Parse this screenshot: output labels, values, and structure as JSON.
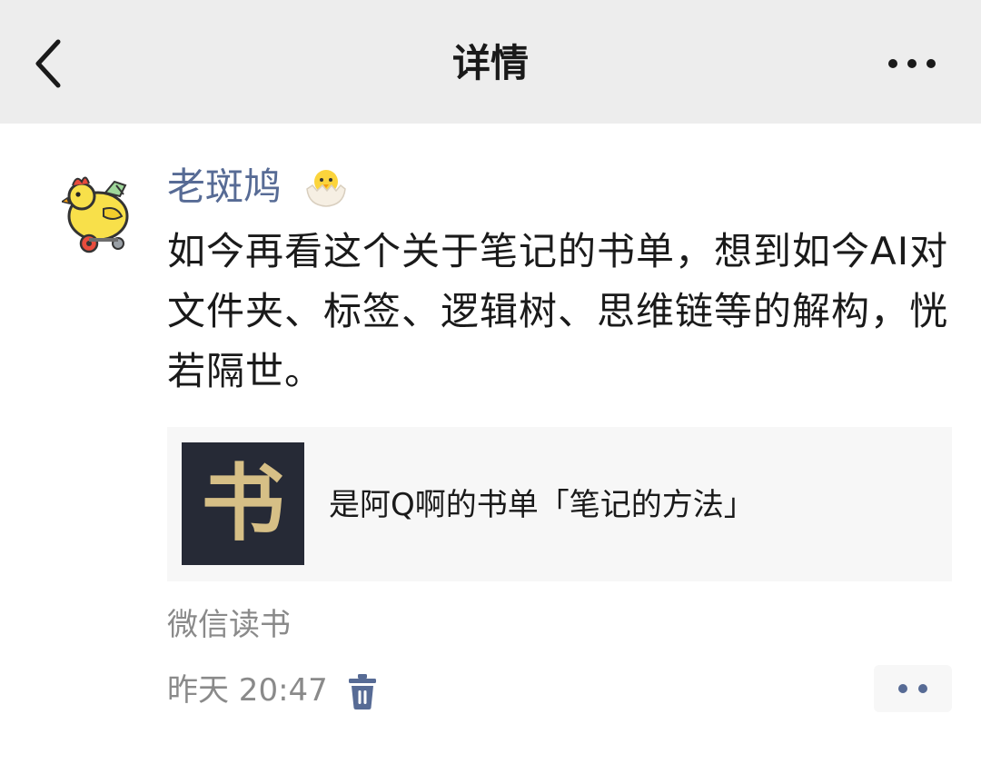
{
  "nav": {
    "title": "详情",
    "back_icon": "chevron-left-icon",
    "more_icon": "more-dots-icon"
  },
  "post": {
    "author": "老斑鸠",
    "author_badge_icon": "hatching-chick-emoji",
    "text": "如今再看这个关于笔记的书单，想到如今AI对文件夹、标签、逻辑树、思维链等的解构，恍若隔世。",
    "card": {
      "cover_char": "书",
      "title": "是阿Q啊的书单「笔记的方法」"
    },
    "source": "微信读书",
    "time": "昨天 20:47",
    "delete_icon": "trash-icon",
    "action_icon": "two-dots-icon"
  },
  "colors": {
    "nav_bg": "#ededed",
    "author_link": "#576b95",
    "meta_text": "#8a8a8a",
    "card_bg": "#f7f7f7",
    "cover_bg": "#262a36",
    "cover_text": "#d6bf86"
  }
}
